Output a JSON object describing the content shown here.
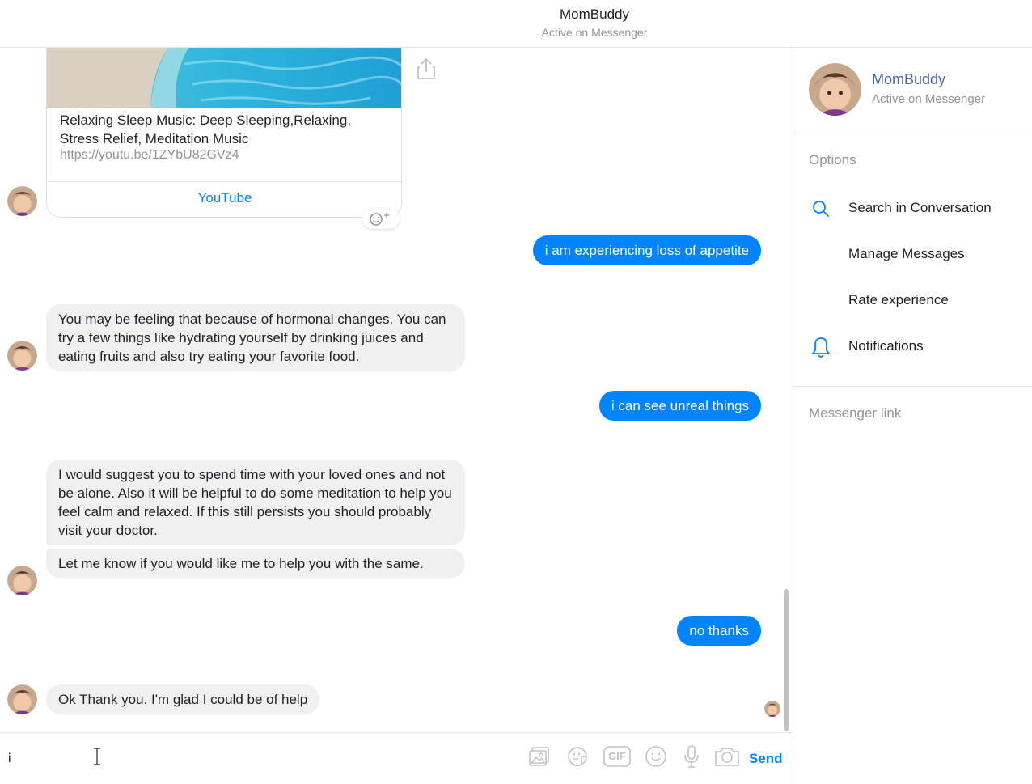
{
  "header": {
    "title": "MomBuddy",
    "subtitle": "Active on Messenger"
  },
  "link_card": {
    "title": "Relaxing Sleep Music: Deep Sleeping,Relaxing, Stress Relief, Meditation Music",
    "url": "https://youtu.be/1ZYbU82GVz4",
    "source": "YouTube"
  },
  "messages": [
    {
      "from": "user",
      "text": "i am experiencing loss of appetite"
    },
    {
      "from": "bot",
      "text": "You may be feeling that because of hormonal changes. You can try a few things like hydrating yourself by drinking juices and eating fruits and also try eating your favorite food."
    },
    {
      "from": "user",
      "text": "i can see unreal things"
    },
    {
      "from": "bot",
      "text": "I would suggest you to spend time with your loved ones and not be alone. Also it will be helpful to do some meditation to help you feel calm and relaxed. If this still persists you should probably visit your doctor."
    },
    {
      "from": "bot",
      "text": "Let me know if you would like me to help you with the same."
    },
    {
      "from": "user",
      "text": "no thanks"
    },
    {
      "from": "bot",
      "text": "Ok Thank you. I'm glad I could be of help"
    }
  ],
  "composer": {
    "value": "i",
    "send_label": "Send",
    "tools": [
      "photo-icon",
      "sticker-icon",
      "gif-icon",
      "emoji-icon",
      "microphone-icon",
      "camera-icon"
    ],
    "gif_label": "GIF"
  },
  "panel": {
    "name": "MomBuddy",
    "status": "Active on Messenger",
    "options_heading": "Options",
    "options": [
      {
        "label": "Search in Conversation",
        "icon": "search-icon"
      },
      {
        "label": "Manage Messages",
        "icon": ""
      },
      {
        "label": "Rate experience",
        "icon": ""
      },
      {
        "label": "Notifications",
        "icon": "bell-icon"
      }
    ],
    "messenger_link_heading": "Messenger link"
  },
  "colors": {
    "accent": "#0084ff",
    "incoming_bubble": "#f1f0f0",
    "muted_text": "#90949c",
    "profile_name": "#4b67a1"
  }
}
